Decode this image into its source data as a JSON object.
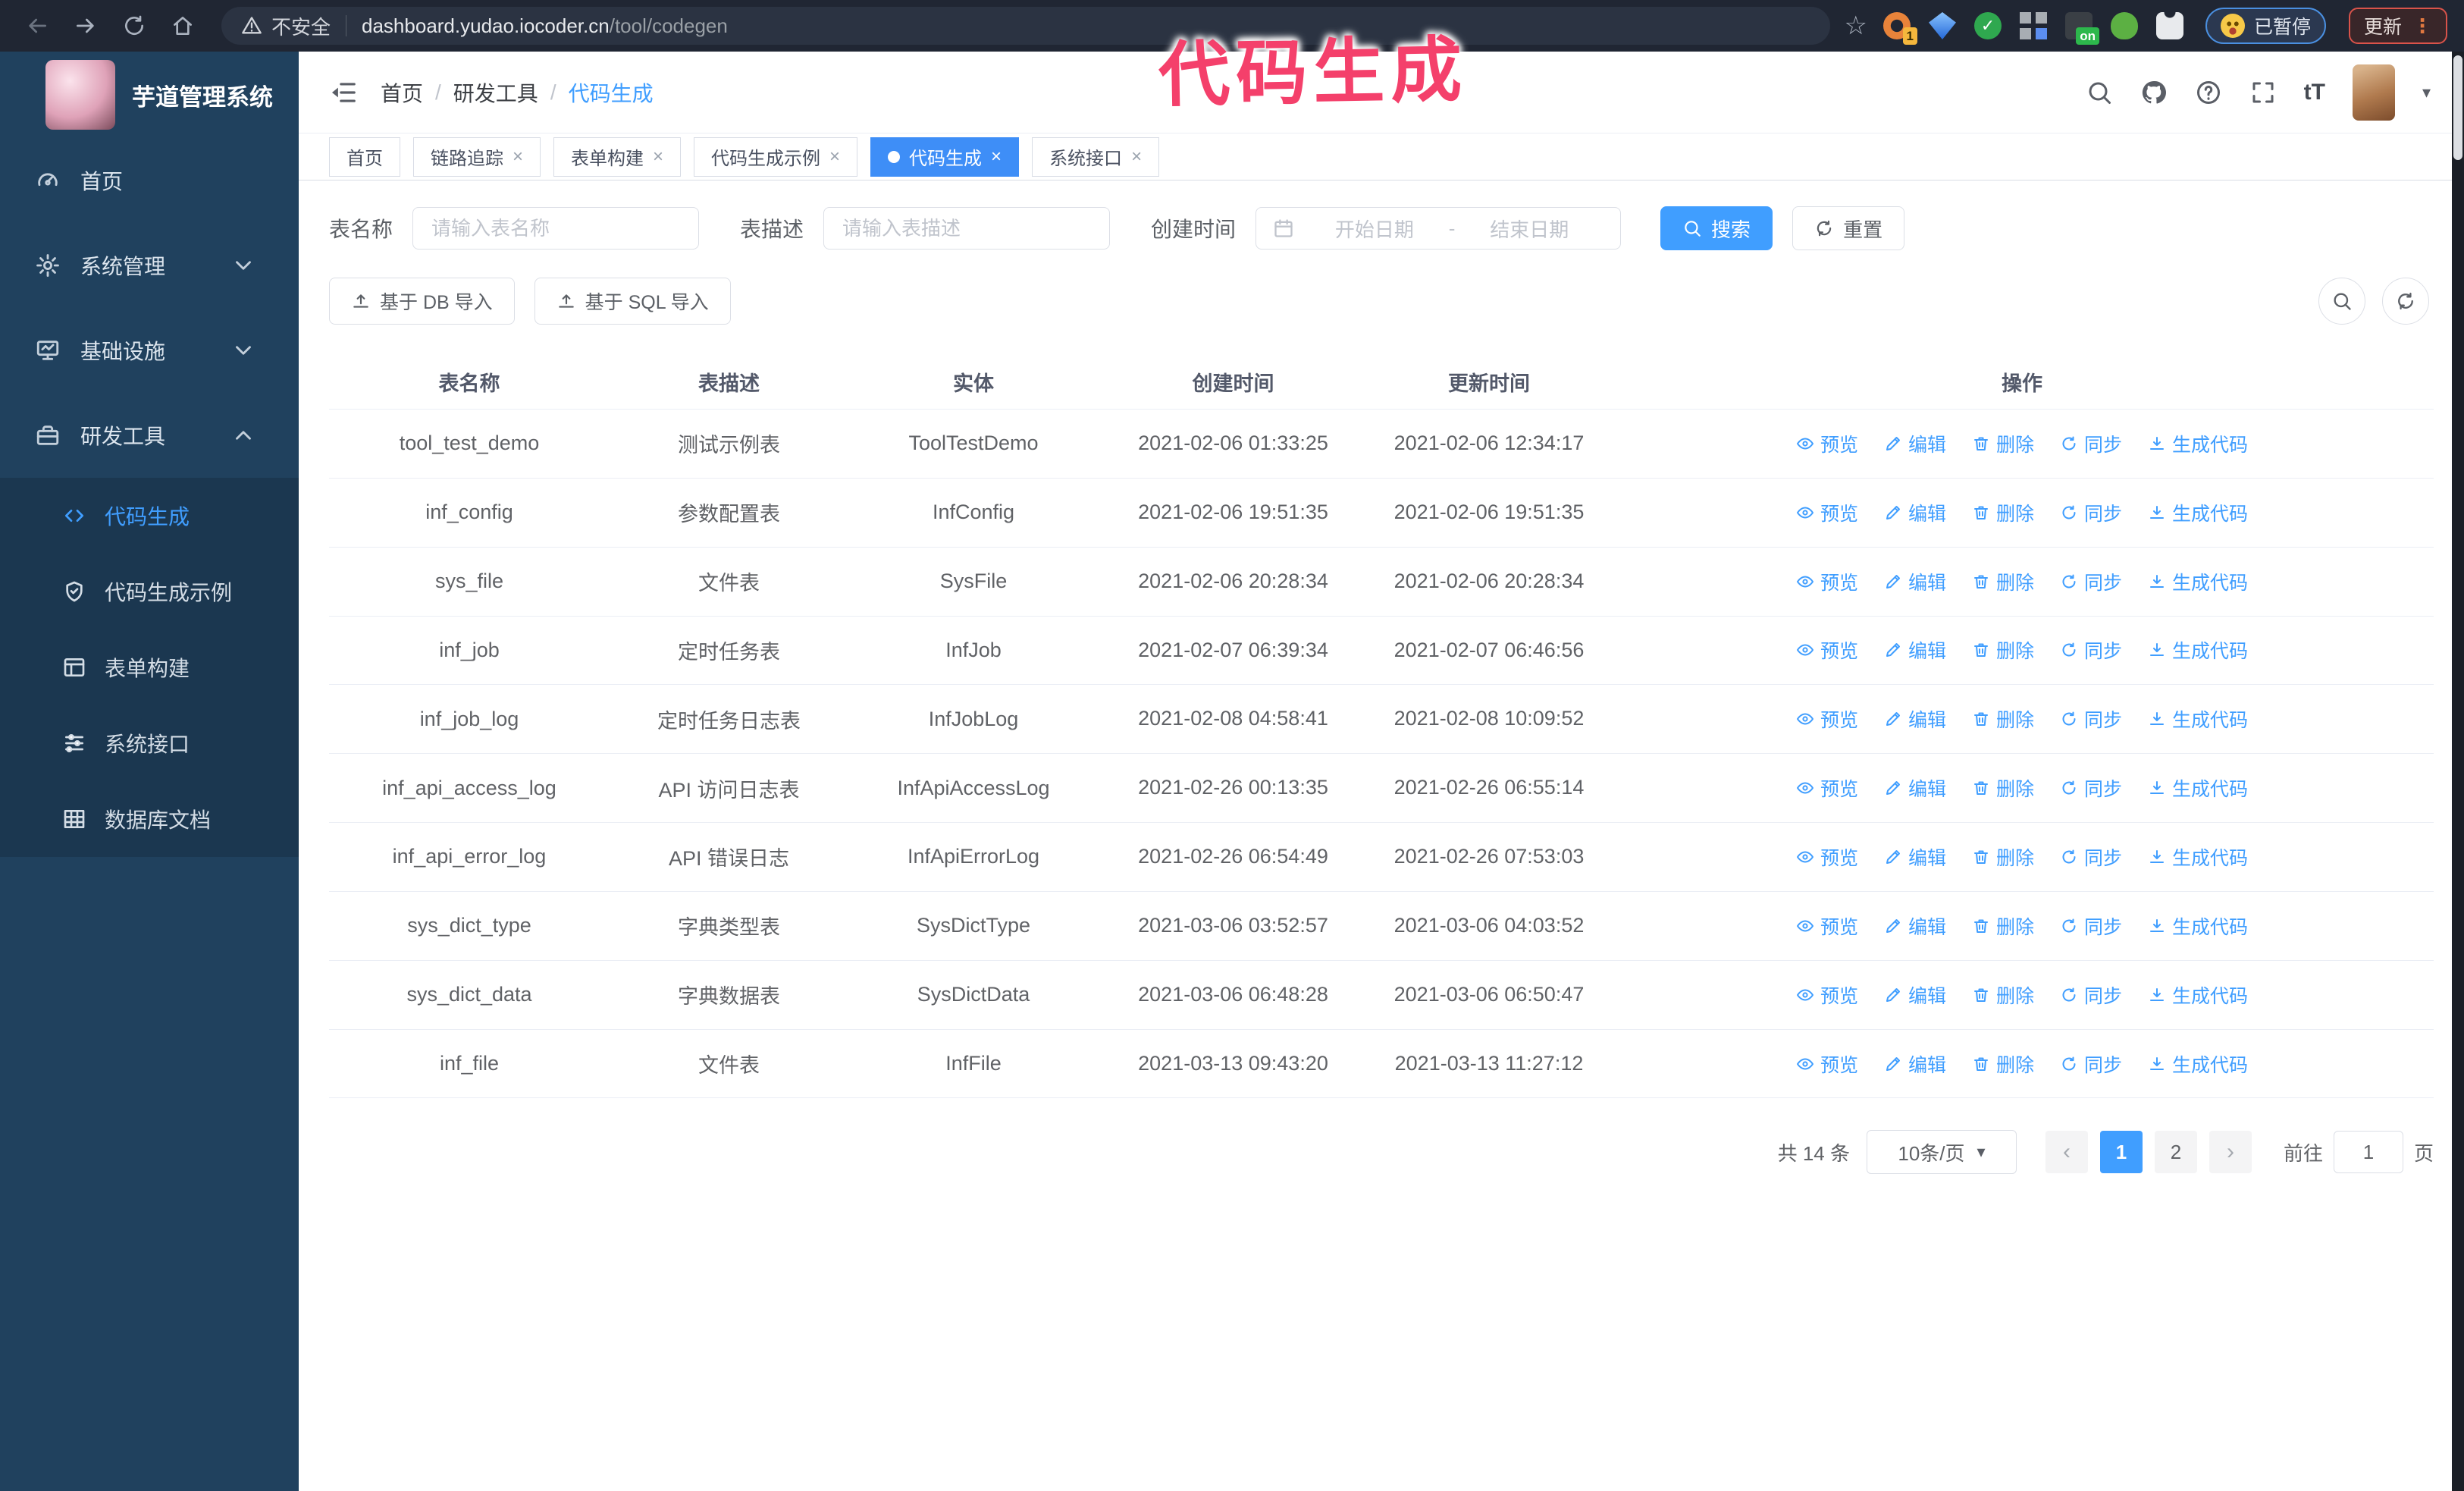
{
  "colors": {
    "accent": "#409eff",
    "tab_active": "#3e8ef7",
    "sidebar_bg": "#20415e",
    "submenu_bg": "#1b3750",
    "annotation": "#f4406b"
  },
  "browser": {
    "security_label": "不安全",
    "url_host": "dashboard.yudao.iocoder.cn",
    "url_path": "/tool/codegen",
    "paused_label": "已暂停",
    "update_label": "更新",
    "extensions": [
      {
        "name": "refresh-orange",
        "badge": "1"
      },
      {
        "name": "blue-gem"
      },
      {
        "name": "green-check",
        "glyph": "✓"
      },
      {
        "name": "grid-diamond"
      },
      {
        "name": "dark-on",
        "badge": "on",
        "badge_green": true
      },
      {
        "name": "green-frog"
      },
      {
        "name": "white-puzzle"
      }
    ]
  },
  "annotation": {
    "text": "代码生成"
  },
  "sidebar": {
    "title": "芋道管理系统",
    "menu": [
      {
        "label": "首页",
        "icon": "gauge",
        "has_children": false
      },
      {
        "label": "系统管理",
        "icon": "gear",
        "has_children": true,
        "expanded": false
      },
      {
        "label": "基础设施",
        "icon": "monitor",
        "has_children": true,
        "expanded": false
      },
      {
        "label": "研发工具",
        "icon": "briefcase",
        "has_children": true,
        "expanded": true
      }
    ],
    "submenu": [
      {
        "label": "代码生成",
        "icon": "code",
        "active": true
      },
      {
        "label": "代码生成示例",
        "icon": "shield",
        "active": false
      },
      {
        "label": "表单构建",
        "icon": "form",
        "active": false
      },
      {
        "label": "系统接口",
        "icon": "sliders",
        "active": false
      },
      {
        "label": "数据库文档",
        "icon": "dbtable",
        "active": false
      }
    ]
  },
  "breadcrumb": {
    "items": [
      {
        "label": "首页",
        "current": false
      },
      {
        "label": "研发工具",
        "current": false
      },
      {
        "label": "代码生成",
        "current": true
      }
    ]
  },
  "tabs": [
    {
      "label": "首页",
      "closable": false,
      "active": false
    },
    {
      "label": "链路追踪",
      "closable": true,
      "active": false
    },
    {
      "label": "表单构建",
      "closable": true,
      "active": false
    },
    {
      "label": "代码生成示例",
      "closable": true,
      "active": false
    },
    {
      "label": "代码生成",
      "closable": true,
      "active": true
    },
    {
      "label": "系统接口",
      "closable": true,
      "active": false
    }
  ],
  "filters": {
    "name_label": "表名称",
    "name_placeholder": "请输入表名称",
    "desc_label": "表描述",
    "desc_placeholder": "请输入表描述",
    "time_label": "创建时间",
    "start_placeholder": "开始日期",
    "range_separator": "-",
    "end_placeholder": "结束日期",
    "search_label": "搜索",
    "reset_label": "重置"
  },
  "toolbar": {
    "db_import_label": "基于 DB 导入",
    "sql_import_label": "基于 SQL 导入"
  },
  "table": {
    "columns": [
      "表名称",
      "表描述",
      "实体",
      "创建时间",
      "更新时间",
      "操作"
    ],
    "actions": [
      {
        "label": "预览",
        "icon": "eye"
      },
      {
        "label": "编辑",
        "icon": "edit"
      },
      {
        "label": "删除",
        "icon": "delete"
      },
      {
        "label": "同步",
        "icon": "sync"
      },
      {
        "label": "生成代码",
        "icon": "download"
      }
    ],
    "rows": [
      {
        "name": "tool_test_demo",
        "desc": "测试示例表",
        "entity": "ToolTestDemo",
        "created": "2021-02-06 01:33:25",
        "updated": "2021-02-06 12:34:17"
      },
      {
        "name": "inf_config",
        "desc": "参数配置表",
        "entity": "InfConfig",
        "created": "2021-02-06 19:51:35",
        "updated": "2021-02-06 19:51:35"
      },
      {
        "name": "sys_file",
        "desc": "文件表",
        "entity": "SysFile",
        "created": "2021-02-06 20:28:34",
        "updated": "2021-02-06 20:28:34"
      },
      {
        "name": "inf_job",
        "desc": "定时任务表",
        "entity": "InfJob",
        "created": "2021-02-07 06:39:34",
        "updated": "2021-02-07 06:46:56"
      },
      {
        "name": "inf_job_log",
        "desc": "定时任务日志表",
        "entity": "InfJobLog",
        "created": "2021-02-08 04:58:41",
        "updated": "2021-02-08 10:09:52"
      },
      {
        "name": "inf_api_access_log",
        "desc": "API 访问日志表",
        "entity": "InfApiAccessLog",
        "created": "2021-02-26 00:13:35",
        "updated": "2021-02-26 06:55:14"
      },
      {
        "name": "inf_api_error_log",
        "desc": "API 错误日志",
        "entity": "InfApiErrorLog",
        "created": "2021-02-26 06:54:49",
        "updated": "2021-02-26 07:53:03"
      },
      {
        "name": "sys_dict_type",
        "desc": "字典类型表",
        "entity": "SysDictType",
        "created": "2021-03-06 03:52:57",
        "updated": "2021-03-06 04:03:52"
      },
      {
        "name": "sys_dict_data",
        "desc": "字典数据表",
        "entity": "SysDictData",
        "created": "2021-03-06 06:48:28",
        "updated": "2021-03-06 06:50:47"
      },
      {
        "name": "inf_file",
        "desc": "文件表",
        "entity": "InfFile",
        "created": "2021-03-13 09:43:20",
        "updated": "2021-03-13 11:27:12"
      }
    ]
  },
  "pagination": {
    "total_label": "共 14 条",
    "page_size_label": "10条/页",
    "prev_label": "‹",
    "next_label": "›",
    "pages": [
      {
        "num": "1",
        "active": true
      },
      {
        "num": "2",
        "active": false
      }
    ],
    "goto_label": "前往",
    "goto_value": "1",
    "unit_label": "页"
  }
}
